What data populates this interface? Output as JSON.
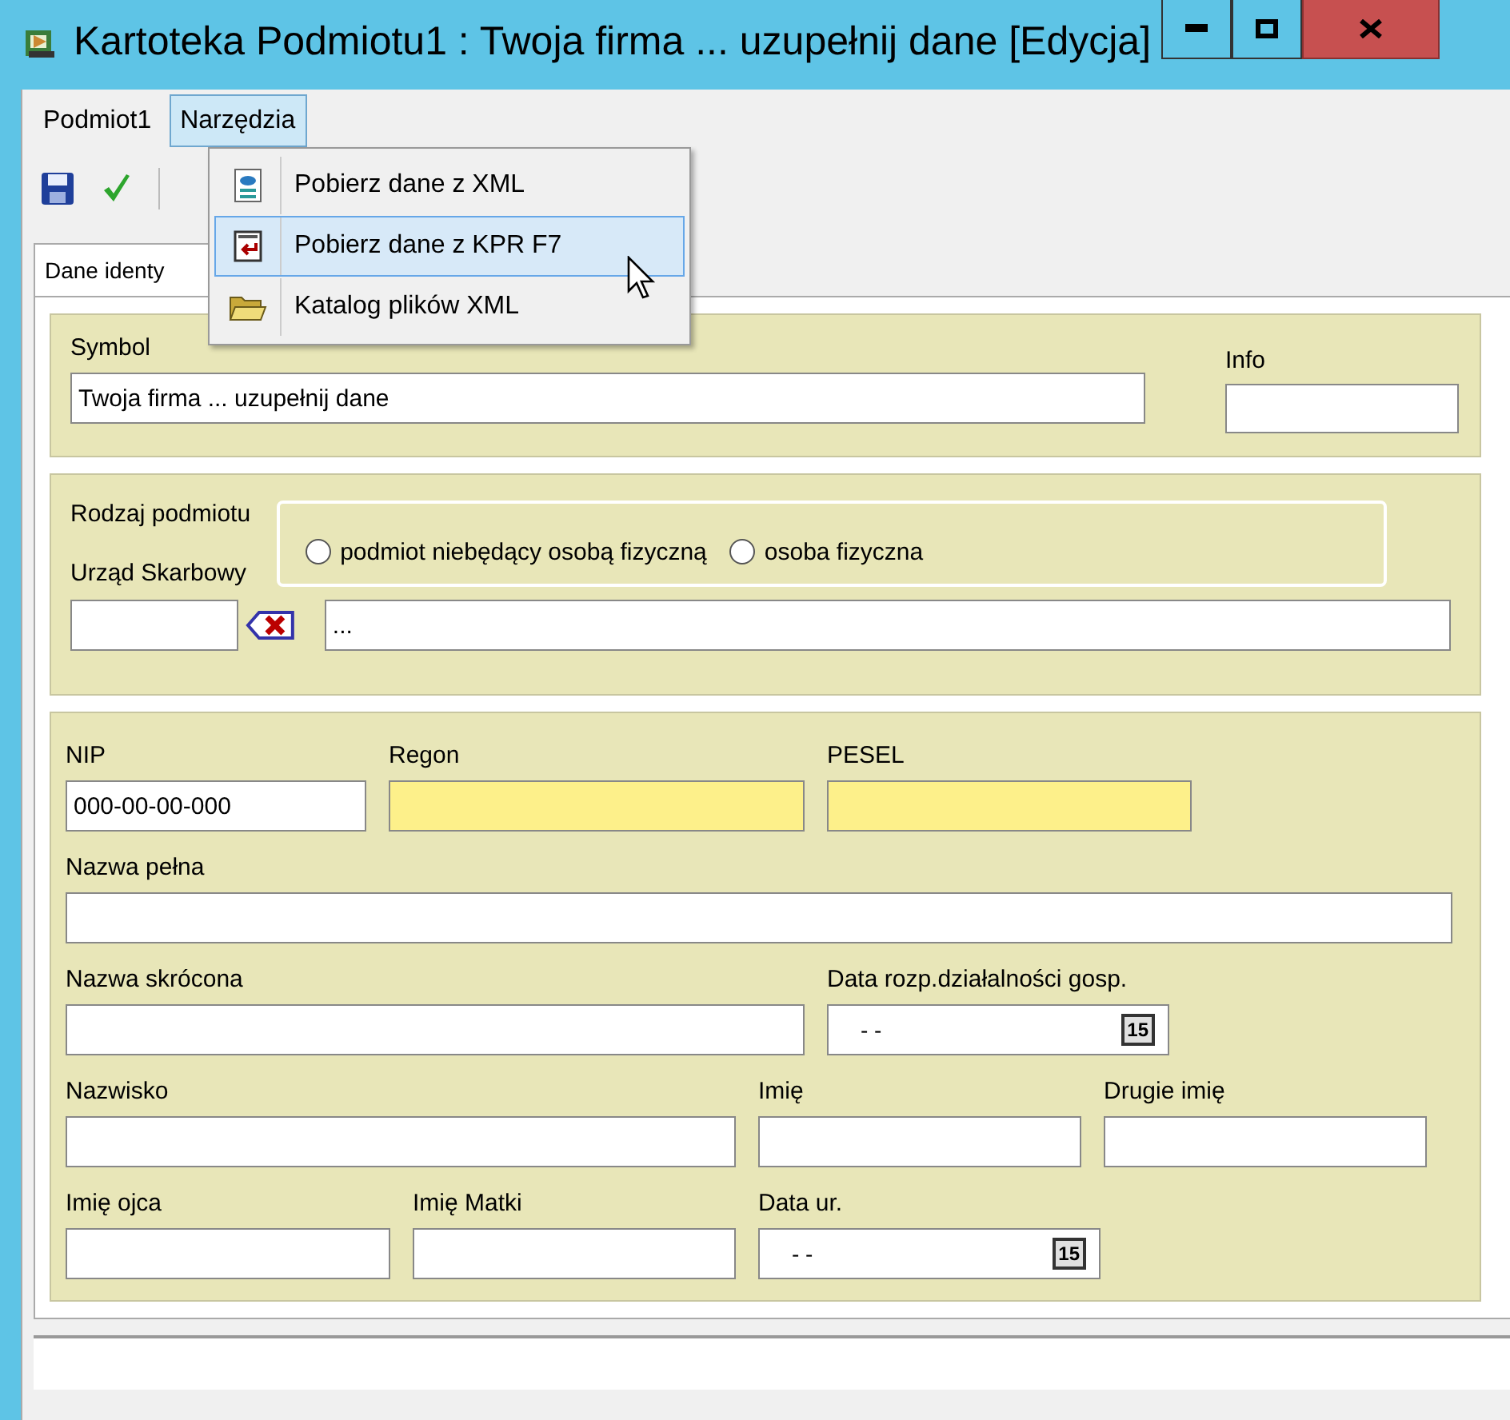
{
  "window": {
    "title": "Kartoteka Podmiotu1 : Twoja firma ... uzupełnij dane [Edycja]"
  },
  "menu": [
    {
      "label": "Podmiot1",
      "selected": false
    },
    {
      "label": "Narzędzia",
      "selected": true
    }
  ],
  "dropdown": [
    {
      "label": "Pobierz dane z XML",
      "kind": "xml",
      "selected": false
    },
    {
      "label": "Pobierz dane z KPR F7",
      "kind": "import",
      "selected": true
    },
    {
      "label": "Katalog plików XML",
      "kind": "folder",
      "selected": false
    }
  ],
  "tabs": [
    {
      "label": "Dane identy",
      "selected": true
    }
  ],
  "symbol": {
    "label": "Symbol",
    "value": "Twoja firma ... uzupełnij dane",
    "info_label": "Info"
  },
  "entity_type": {
    "label": "Rodzaj podmiotu",
    "options": [
      {
        "label": "podmiot niebędący osobą fizyczną",
        "selected": false
      },
      {
        "label": "osoba fizyczna",
        "selected": false
      }
    ]
  },
  "tax_office": {
    "label": "Urząd Skarbowy",
    "name_value": "..."
  },
  "rows": [
    [
      {
        "kind": "text",
        "label": "NIP",
        "value": "000-00-00-000",
        "highlighted": false
      },
      {
        "kind": "text",
        "label": "Regon",
        "highlighted": true
      },
      {
        "kind": "text",
        "label": "PESEL",
        "highlighted": true
      }
    ],
    [
      {
        "kind": "text",
        "label": "Nazwa pełna",
        "highlighted": false
      }
    ],
    [
      {
        "kind": "text",
        "label": "Nazwa skrócona",
        "highlighted": false
      },
      {
        "kind": "date",
        "label": "Data rozp.działalności gosp.",
        "value": "- -",
        "calendar": "15"
      }
    ],
    [
      {
        "kind": "text",
        "label": "Nazwisko",
        "highlighted": false
      },
      {
        "kind": "text",
        "label": "Imię",
        "highlighted": false
      },
      {
        "kind": "text",
        "label": "Drugie imię",
        "highlighted": false
      }
    ],
    [
      {
        "kind": "text",
        "label": "Imię ojca",
        "highlighted": false
      },
      {
        "kind": "text",
        "label": "Imię Matki",
        "highlighted": false
      },
      {
        "kind": "date",
        "label": "Data ur.",
        "value": "- -",
        "calendar": "15"
      }
    ]
  ]
}
